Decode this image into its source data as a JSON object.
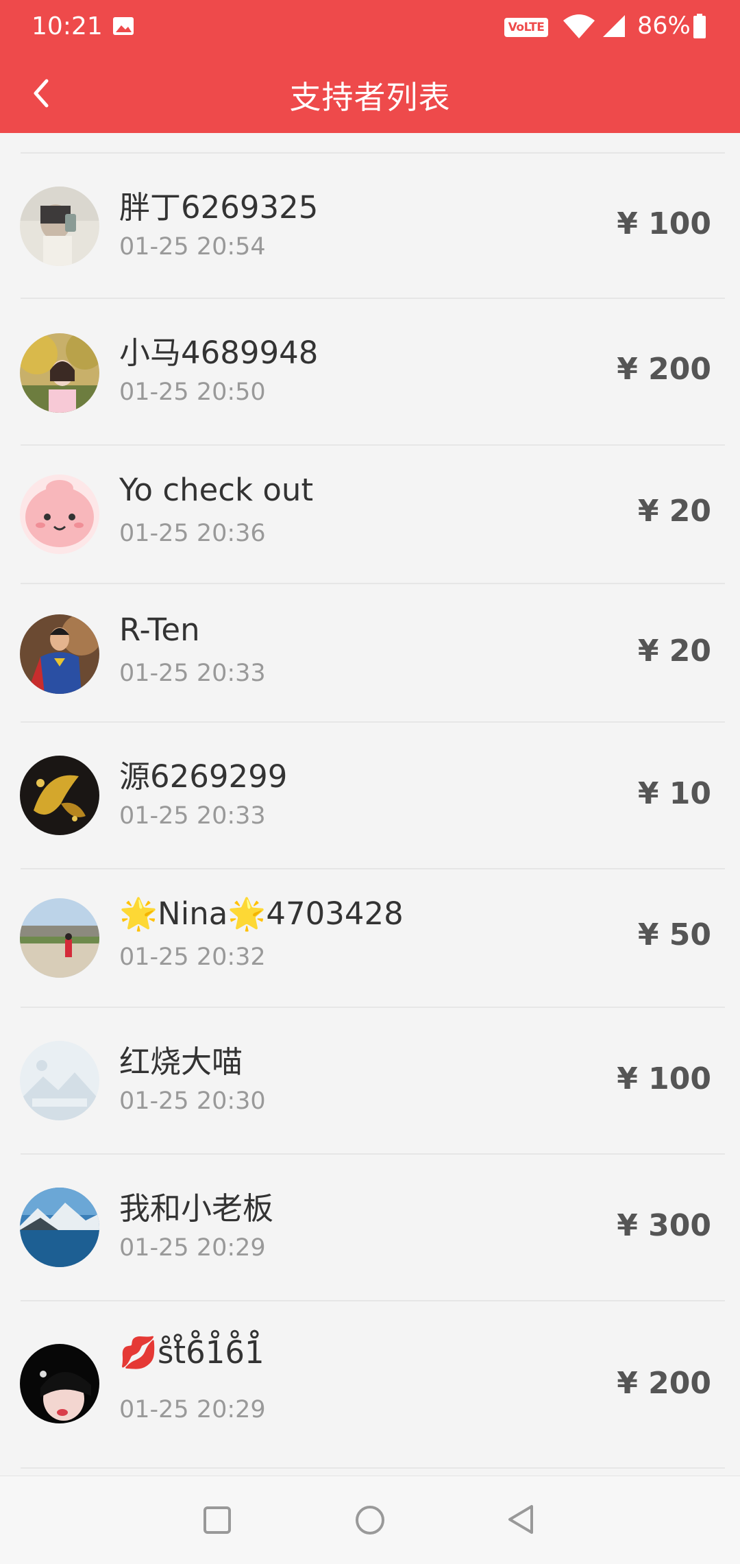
{
  "status_bar": {
    "time": "10:21",
    "volte": "VoLTE",
    "battery": "86%"
  },
  "header": {
    "title": "支持者列表",
    "accent_color": "#ee4a4b"
  },
  "supporters": [
    {
      "name": "胖丁6269325",
      "time": "01-25 20:54",
      "amount": "¥ 100"
    },
    {
      "name": "小马4689948",
      "time": "01-25 20:50",
      "amount": "¥ 200"
    },
    {
      "name": "Yo check out",
      "time": "01-25 20:36",
      "amount": "¥ 20"
    },
    {
      "name": "R-Ten",
      "time": "01-25 20:33",
      "amount": "¥ 20"
    },
    {
      "name": "源6269299",
      "time": "01-25 20:33",
      "amount": "¥ 10"
    },
    {
      "name": "🌟Nina🌟4703428",
      "time": "01-25 20:32",
      "amount": "¥ 50"
    },
    {
      "name": "红烧大喵",
      "time": "01-25 20:30",
      "amount": "¥ 100"
    },
    {
      "name": "我和小老板",
      "time": "01-25 20:29",
      "amount": "¥ 300"
    },
    {
      "name": "💋s̊t̊6̊1̊6̊1̊̊̊̊",
      "time": "01-25 20:29",
      "amount": "¥ 200"
    }
  ]
}
